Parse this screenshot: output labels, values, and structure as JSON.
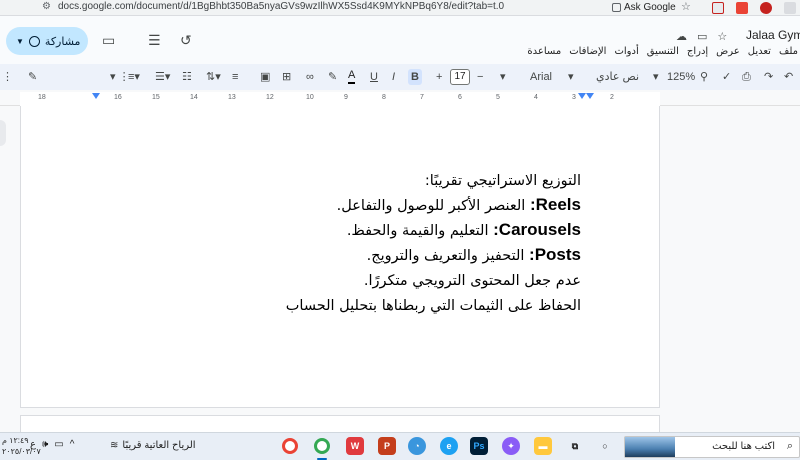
{
  "browser": {
    "url": "docs.google.com/document/d/1BgBhbt350Ba5nyaGVs9wzIlhWX5Ssd4K9MYkNPBq6Y8/edit?tab=t.0",
    "ask_google": "Ask Google"
  },
  "header": {
    "doc_title": "Jalaa Gym",
    "share_label": "مشاركة",
    "menu": [
      "ملف",
      "تعديل",
      "عرض",
      "إدراج",
      "التنسيق",
      "أدوات",
      "الإضافات",
      "مساعدة"
    ]
  },
  "toolbar": {
    "zoom": "125%",
    "style": "نص عادي",
    "font": "Arial",
    "font_size": "17",
    "plus": "+",
    "minus": "−"
  },
  "ruler": {
    "numbers": [
      "18",
      "17",
      "16",
      "15",
      "14",
      "13",
      "12",
      "11",
      "10",
      "9",
      "8",
      "7",
      "6",
      "5",
      "4",
      "3",
      "2",
      "1"
    ]
  },
  "document": {
    "lines": [
      {
        "bold": "",
        "text": "التوزيع الاستراتيجي تقريبًا:"
      },
      {
        "bold": "Reels:",
        "text": " العنصر الأكبر للوصول والتفاعل."
      },
      {
        "bold": "Carousels:",
        "text": " التعليم والقيمة والحفظ."
      },
      {
        "bold": "Posts:",
        "text": " التحفيز والتعريف والترويج."
      },
      {
        "bold": "",
        "text": "عدم جعل المحتوى الترويجي متكررًا."
      },
      {
        "bold": "",
        "text": "الحفاظ على الثيمات التي ربطناها بتحليل الحساب"
      }
    ]
  },
  "taskbar": {
    "time": "١٢:٤٩ م",
    "date": "٢٠٢٥/٠٣/٠٧",
    "weather": "الرياح العاتية قريبًا",
    "search_placeholder": "اكتب هنا للبحث",
    "lang": "ع"
  }
}
